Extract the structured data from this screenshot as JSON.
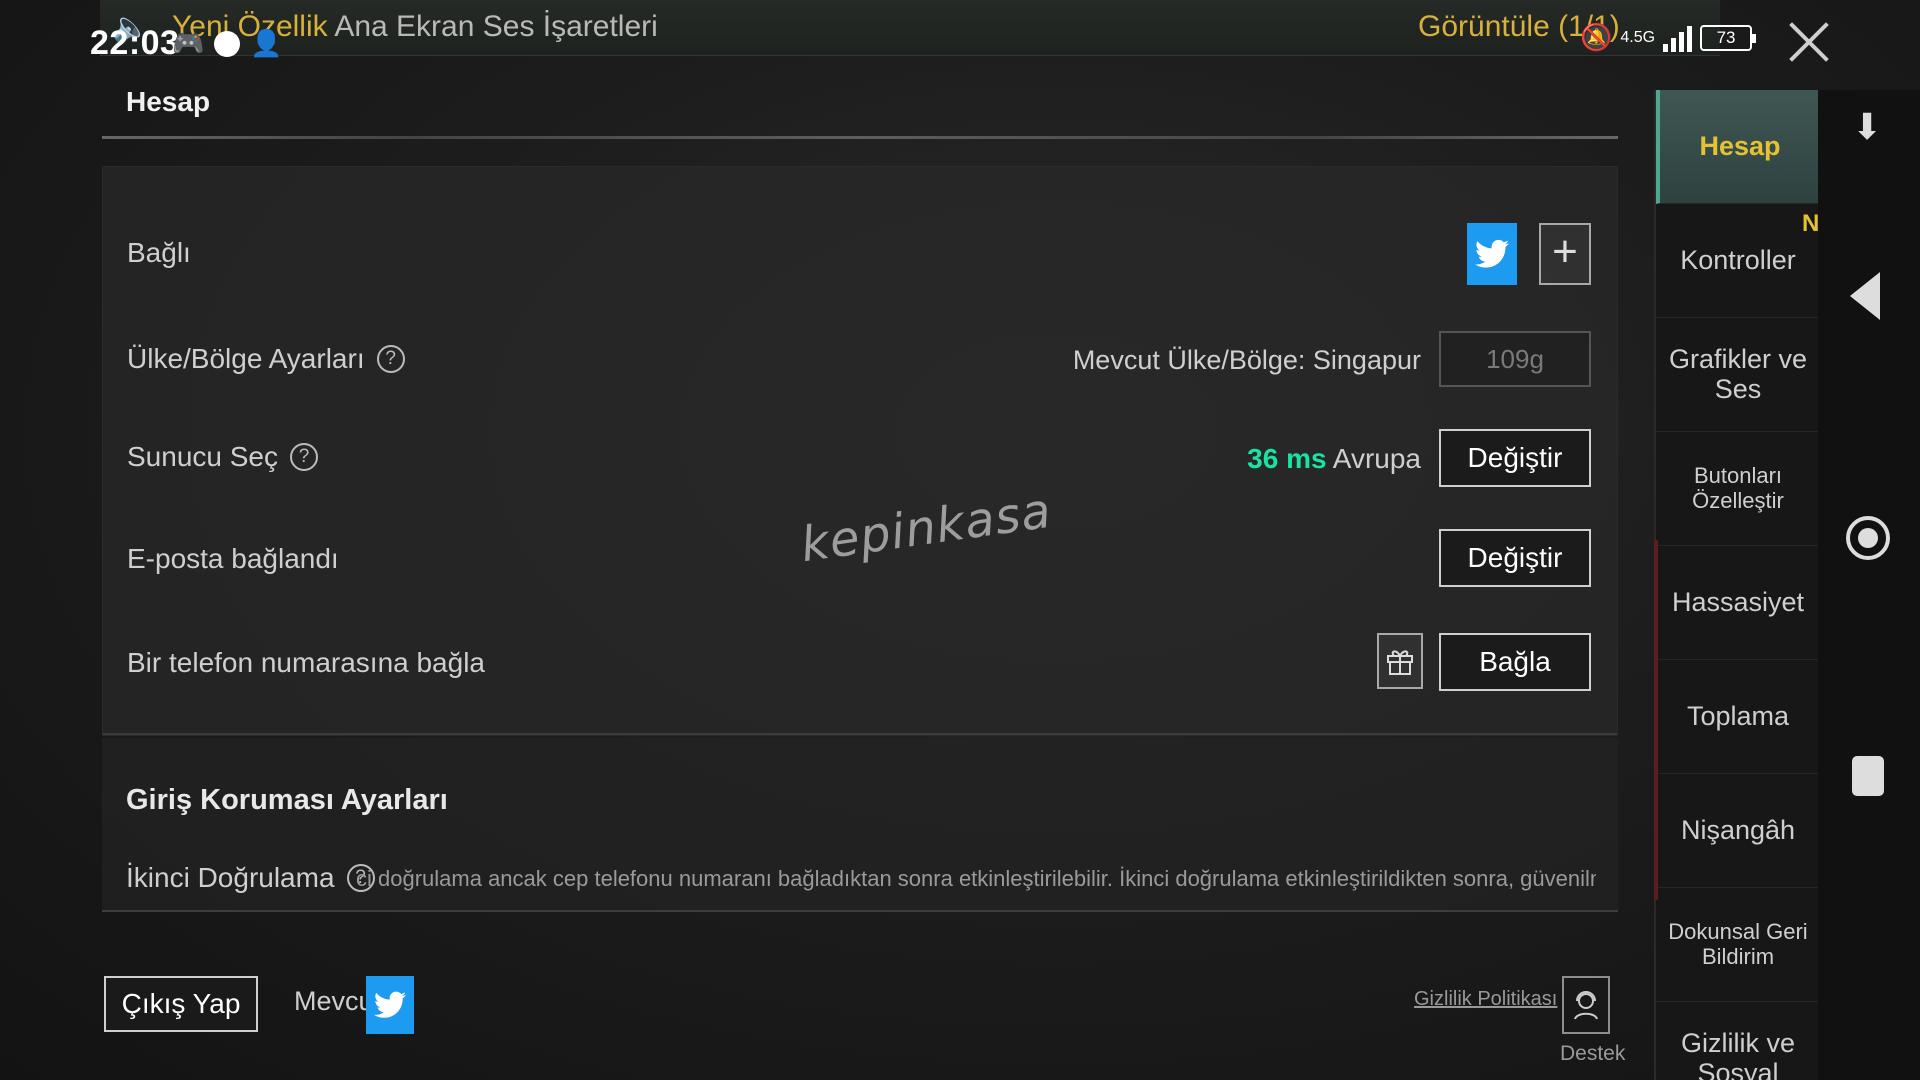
{
  "status_bar": {
    "time": "22:03",
    "network": "4.5G",
    "battery": "73"
  },
  "notice": {
    "highlight": "Yeni Özellik",
    "text": "Ana Ekran Ses İşaretleri",
    "view_label": "Görüntüle (1/1)"
  },
  "section": {
    "title": "Hesap"
  },
  "rows": {
    "linked_label": "Bağlı",
    "region_label": "Ülke/Bölge Ayarları",
    "region_current": "Mevcut Ülke/Bölge: Singapur",
    "region_cooldown": "109g",
    "server_label": "Sunucu Seç",
    "ping_value": "36",
    "ping_unit": "ms",
    "server_name": "Avrupa",
    "change_label": "Değiştir",
    "email_label": "E-posta bağlandı",
    "email_change_label": "Değiştir",
    "phone_label": "Bir telefon numarasına bağla",
    "bind_label": "Bağla"
  },
  "protection": {
    "title": "Giriş Koruması Ayarları",
    "second_auth_label": "İkinci Doğrulama",
    "second_auth_desc": "ci doğrulama ancak cep telefonu numaranı bağladıktan sonra etkinleştirilebilir. İkinci doğrulama etkinleştirildikten sonra, güvenilmeyen cihazlardan oyur"
  },
  "bottom": {
    "logout_label": "Çıkış Yap",
    "current_label": "Mevcut",
    "privacy_label": "Gizlilik Politikası",
    "support_label": "Destek"
  },
  "watermark": "kepinkasa",
  "sidebar": {
    "items": [
      {
        "label": "Hesap"
      },
      {
        "label": "Kontroller",
        "badge": "NEW"
      },
      {
        "label": "Grafikler ve Ses"
      },
      {
        "label": "Butonları Özelleştir"
      },
      {
        "label": "Hassasiyet"
      },
      {
        "label": "Toplama"
      },
      {
        "label": "Nişangâh"
      },
      {
        "label": "Dokunsal Geri Bildirim"
      },
      {
        "label": "Gizlilik ve Sosyal"
      }
    ]
  },
  "colors": {
    "twitter": "#1d9bf0",
    "ping": "#19e3a4",
    "accent_gold": "#e6c233",
    "active_tab": "#3f5754"
  }
}
